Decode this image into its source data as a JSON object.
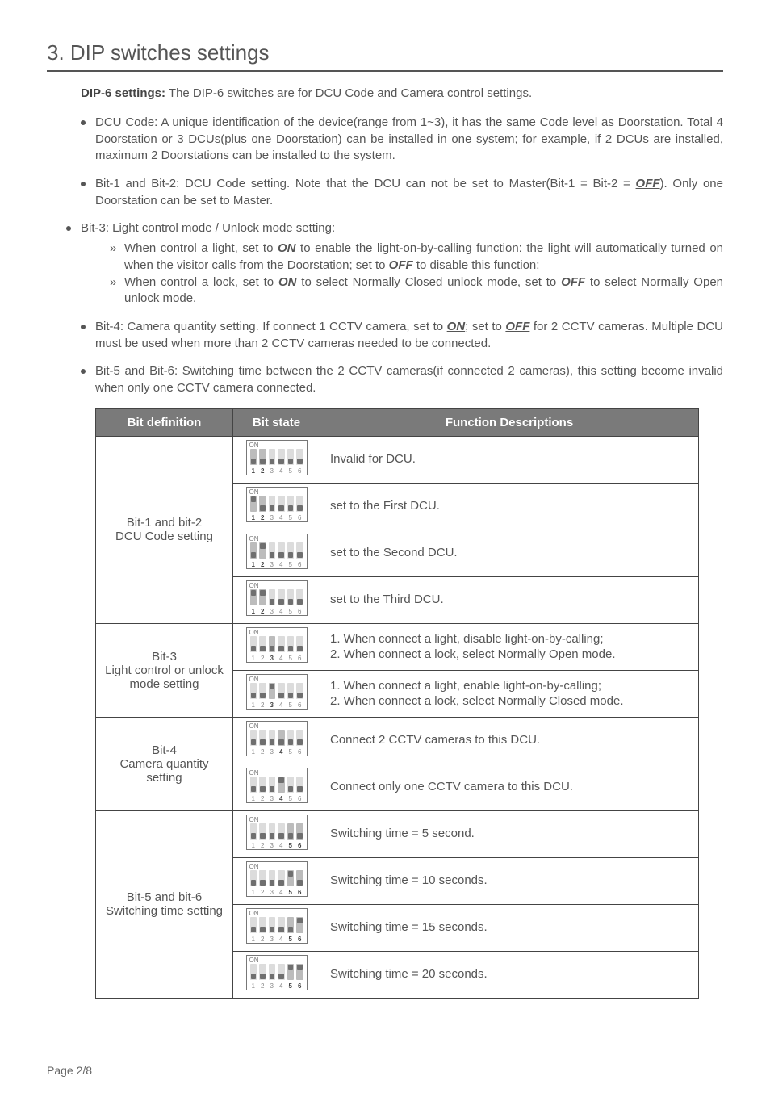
{
  "section_title": "3. DIP switches settings",
  "intro": {
    "label": "DIP-6 settings:",
    "text": "The DIP-6 switches are for DCU Code and Camera control settings."
  },
  "bullets": {
    "b1": "DCU Code:  A unique identification of the device(range from 1~3), it has the same Code level as Doorstation. Total 4 Doorstation or 3 DCUs(plus one Doorstation) can be installed in one system; for example, if 2 DCUs are installed, maximum 2 Doorstations can be installed to the system.",
    "b2_a": "Bit-1 and Bit-2: DCU Code setting. Note that the DCU can not be set to Master(Bit-1 = Bit-2 = ",
    "b2_off": "OFF",
    "b2_b": "). Only one Doorstation can be set to Master.",
    "b3_head": "Bit-3: Light control mode / Unlock mode setting:",
    "b3_s1_a": "When control a light, set to ",
    "b3_s1_on": "ON",
    "b3_s1_b": " to enable the light-on-by-calling function: the light will automatically turned on when the visitor calls from the Doorstation; set to ",
    "b3_s1_off": "OFF",
    "b3_s1_c": " to disable this function;",
    "b3_s2_a": "When control a lock, set to ",
    "b3_s2_on": "ON",
    "b3_s2_b": " to select Normally Closed unlock mode, set to ",
    "b3_s2_off": "OFF",
    "b3_s2_c": " to select Normally Open unlock mode.",
    "b4_a": "Bit-4: Camera quantity setting. If connect 1 CCTV camera, set to ",
    "b4_on": "ON",
    "b4_b": "; set to ",
    "b4_off": "OFF",
    "b4_c": " for 2 CCTV cameras. Multiple DCU must be used when more than 2 CCTV cameras needed to be connected.",
    "b5": "Bit-5 and Bit-6: Switching time between the 2 CCTV cameras(if connected 2 cameras), this setting become invalid when only one CCTV camera connected."
  },
  "table": {
    "headers": {
      "h1": "Bit definition",
      "h2": "Bit state",
      "h3": "Function Descriptions"
    },
    "groups": [
      {
        "def_lines": [
          "Bit-1 and bit-2",
          "DCU Code setting"
        ],
        "highlight": [
          1,
          2
        ],
        "rows": [
          {
            "states": [
              0,
              0,
              0,
              0,
              0,
              0
            ],
            "desc": "Invalid for DCU."
          },
          {
            "states": [
              1,
              0,
              0,
              0,
              0,
              0
            ],
            "desc": "set to the First DCU."
          },
          {
            "states": [
              0,
              1,
              0,
              0,
              0,
              0
            ],
            "desc": "set to the Second DCU."
          },
          {
            "states": [
              1,
              1,
              0,
              0,
              0,
              0
            ],
            "desc": "set to the Third DCU."
          }
        ]
      },
      {
        "def_lines": [
          "Bit-3",
          "Light control or unlock",
          "mode setting"
        ],
        "highlight": [
          3
        ],
        "rows": [
          {
            "states": [
              0,
              0,
              0,
              0,
              0,
              0
            ],
            "desc": "1. When connect a light, disable light-on-by-calling;\n2. When connect a lock, select Normally Open mode."
          },
          {
            "states": [
              0,
              0,
              1,
              0,
              0,
              0
            ],
            "desc": "1. When connect a light, enable light-on-by-calling;\n2. When connect a lock, select Normally Closed mode."
          }
        ]
      },
      {
        "def_lines": [
          "Bit-4",
          "Camera quantity setting"
        ],
        "highlight": [
          4
        ],
        "rows": [
          {
            "states": [
              0,
              0,
              0,
              0,
              0,
              0
            ],
            "desc": "Connect 2 CCTV cameras to this DCU."
          },
          {
            "states": [
              0,
              0,
              0,
              1,
              0,
              0
            ],
            "desc": "Connect only one CCTV camera to this DCU."
          }
        ]
      },
      {
        "def_lines": [
          "Bit-5 and bit-6",
          "Switching time setting"
        ],
        "highlight": [
          5,
          6
        ],
        "rows": [
          {
            "states": [
              0,
              0,
              0,
              0,
              0,
              0
            ],
            "desc": "Switching time = 5 second."
          },
          {
            "states": [
              0,
              0,
              0,
              0,
              1,
              0
            ],
            "desc": "Switching time = 10 seconds."
          },
          {
            "states": [
              0,
              0,
              0,
              0,
              0,
              1
            ],
            "desc": "Switching time = 15 seconds."
          },
          {
            "states": [
              0,
              0,
              0,
              0,
              1,
              1
            ],
            "desc": "Switching time = 20 seconds."
          }
        ]
      }
    ]
  },
  "footer": "Page  2/8",
  "dip_on_label": "ON"
}
